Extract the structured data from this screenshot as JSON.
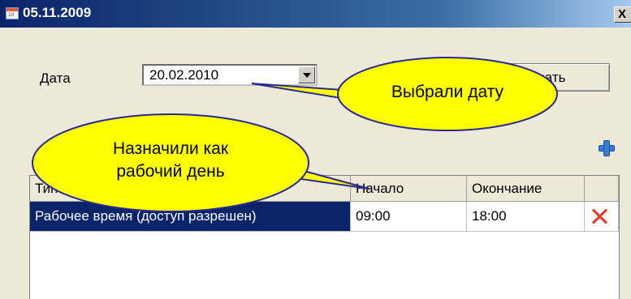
{
  "window": {
    "title": "05.11.2009",
    "close_glyph": "X",
    "icon": "calendar-icon"
  },
  "form": {
    "date_label": "Дата",
    "date_value": "20.02.2010"
  },
  "buttons": {
    "ok_label": "",
    "apply_label": "ровать"
  },
  "grid": {
    "columns": [
      "Тип",
      "Начало",
      "Окончание"
    ],
    "rows": [
      {
        "type": "Рабочее время (доступ разрешен)",
        "start": "09:00",
        "end": "18:00",
        "selected": true
      }
    ]
  },
  "callouts": {
    "date": "Выбрали дату",
    "workday_line1": "Назначили как",
    "workday_line2": "рабочий день"
  },
  "colors": {
    "selection": "#0a246a",
    "callout_fill": "#ffff00",
    "delete": "#e8361c",
    "add": "#3a7bd5"
  }
}
